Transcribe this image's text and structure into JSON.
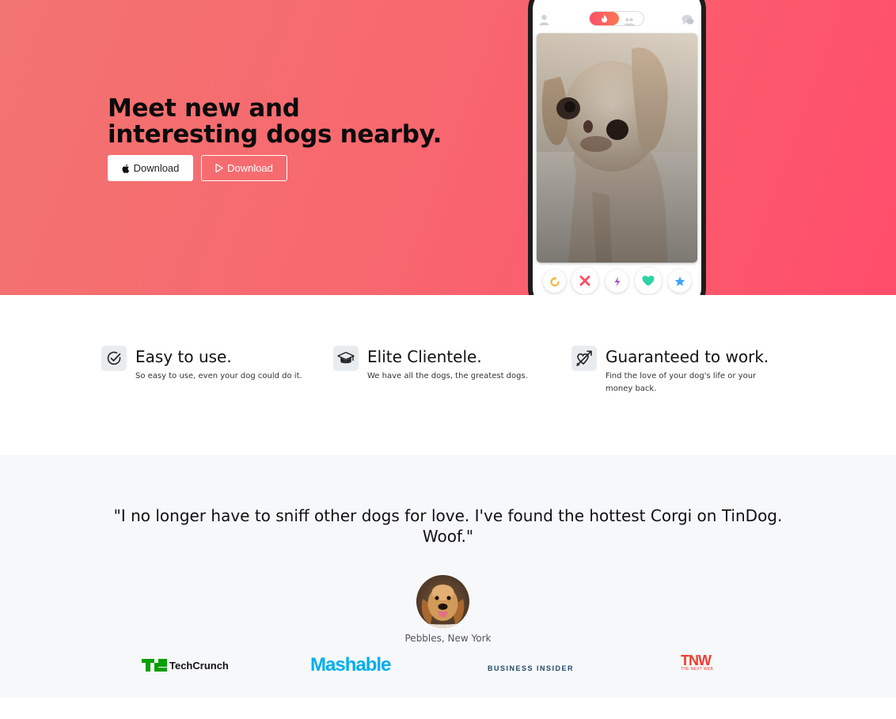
{
  "hero": {
    "title": "Meet new and interesting dogs nearby.",
    "apple_button_label": "Download",
    "play_button_label": "Download",
    "gradient_colors": [
      "#f27471",
      "#ff4d6b"
    ]
  },
  "phone": {
    "header_icons": [
      "user-icon",
      "flame-icon",
      "people-icon",
      "chat-icon"
    ],
    "action_icons": [
      "rewind-icon",
      "nope-icon",
      "boost-icon",
      "like-icon",
      "super-like-icon"
    ],
    "action_colors": {
      "rewind": "#f5b748",
      "nope": "#fd5068",
      "boost": "#a94fd8",
      "like": "#2ed3a5",
      "super_like": "#3ca4ff"
    }
  },
  "features": [
    {
      "icon": "check-circle-icon",
      "title": "Easy to use.",
      "text": "So easy to use, even your dog could do it."
    },
    {
      "icon": "graduation-cap-icon",
      "title": "Elite Clientele.",
      "text": "We have all the dogs, the greatest dogs."
    },
    {
      "icon": "heart-arrow-icon",
      "title": "Guaranteed to work.",
      "text": "Find the love of your dog's life or your money back."
    }
  ],
  "testimonial": {
    "quote": "\"I no longer have to sniff other dogs for love. I've found the hottest Corgi on TinDog. Woof.\"",
    "author": "Pebbles, New York"
  },
  "press": {
    "techcrunch": "TechCrunch",
    "mashable": "Mashable",
    "business_insider": "BUSINESS INSIDER",
    "tnw": "TNW",
    "tnw_sub": "THE NEXT WEB"
  }
}
